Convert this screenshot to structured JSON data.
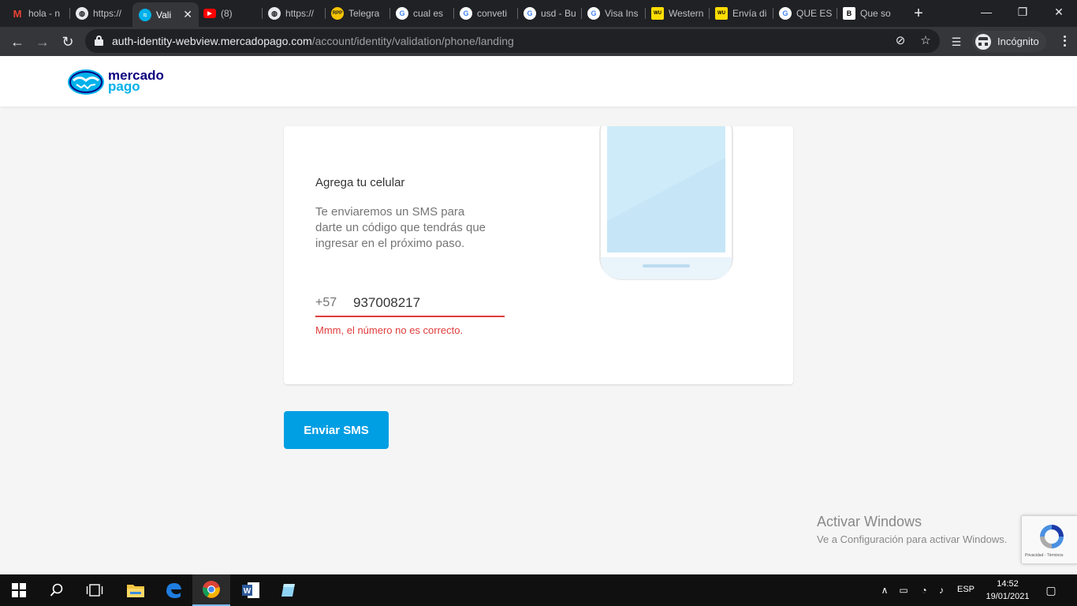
{
  "browser": {
    "tabs": [
      {
        "label": "hola - n",
        "favicon": "gmail-icon"
      },
      {
        "label": "https://",
        "favicon": "globe-icon"
      },
      {
        "label": "Vali",
        "favicon": "mercadopago-icon",
        "active": true
      },
      {
        "label": "(8)",
        "favicon": "youtube-icon"
      },
      {
        "label": "https://",
        "favicon": "globe-icon"
      },
      {
        "label": "Telegra",
        "favicon": "rpp-icon"
      },
      {
        "label": "cual es",
        "favicon": "google-icon"
      },
      {
        "label": "conveti",
        "favicon": "google-icon"
      },
      {
        "label": "usd - Bu",
        "favicon": "google-icon"
      },
      {
        "label": "Visa Ins",
        "favicon": "google-icon"
      },
      {
        "label": "Western",
        "favicon": "western-union-icon"
      },
      {
        "label": "Envía di",
        "favicon": "western-union-icon"
      },
      {
        "label": "QUE ES",
        "favicon": "google-icon"
      },
      {
        "label": "Que so",
        "favicon": "b-icon"
      }
    ],
    "url_host": "auth-identity-webview.mercadopago.com",
    "url_path": "/account/identity/validation/phone/landing",
    "profile_label": "Incógnito"
  },
  "site": {
    "logo_line1": "mercado",
    "logo_line2": "pago"
  },
  "form": {
    "title": "Agrega tu celular",
    "description": "Te enviaremos un SMS para darte un código que tendrás que ingresar en el próximo paso.",
    "country_code": "+57",
    "phone_value": "937008217",
    "error": "Mmm, el número no es correcto.",
    "submit_label": "Enviar SMS"
  },
  "windows_notice": {
    "title": "Activar Windows",
    "subtitle": "Ve a Configuración para activar Windows."
  },
  "recaptcha": {
    "text": "Privacidad - Términos"
  },
  "taskbar": {
    "language": "ESP",
    "time": "14:52",
    "date": "19/01/2021"
  },
  "colors": {
    "brand_blue": "#009ee3",
    "error_red": "#e03c3c",
    "logo_navy": "#0a0080"
  }
}
